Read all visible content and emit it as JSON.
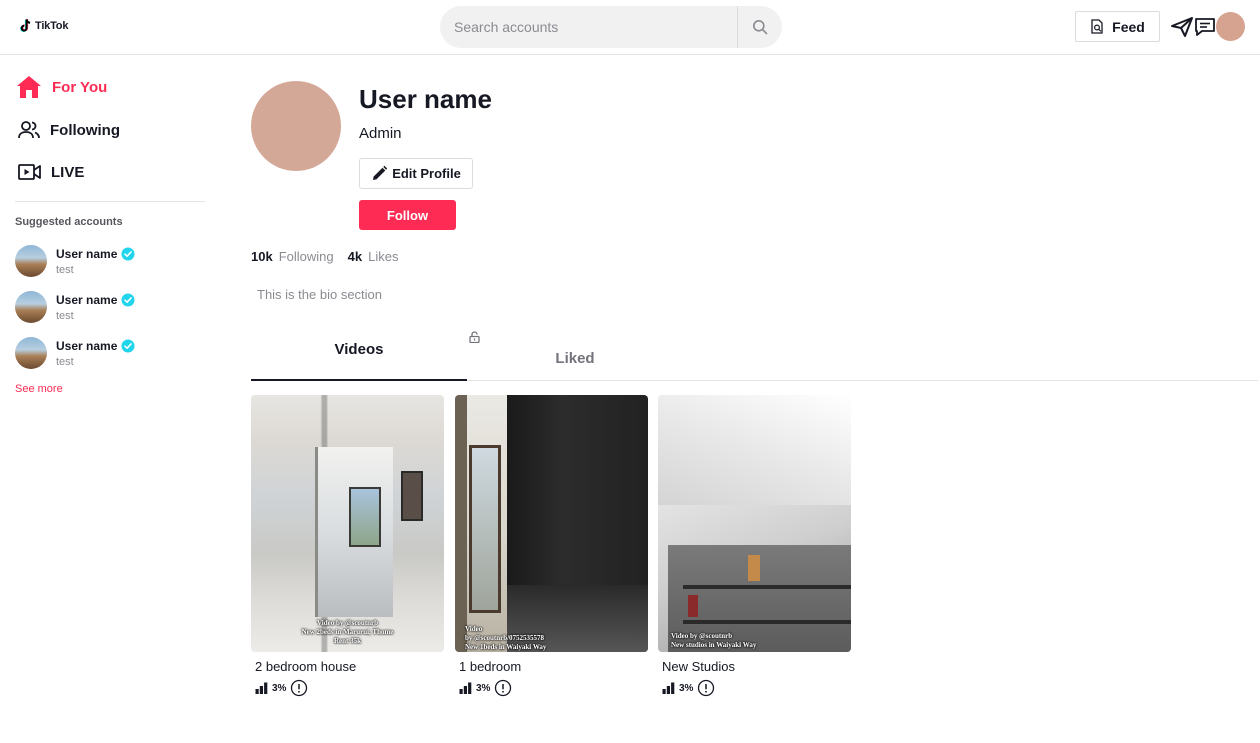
{
  "header": {
    "logo_text": "TikTok",
    "search_placeholder": "Search accounts",
    "feed_label": "Feed"
  },
  "sidebar": {
    "nav": [
      {
        "label": "For You",
        "icon": "home-icon",
        "active": true
      },
      {
        "label": "Following",
        "icon": "users-icon",
        "active": false
      },
      {
        "label": "LIVE",
        "icon": "live-video-icon",
        "active": false
      }
    ],
    "suggested_title": "Suggested accounts",
    "suggested": [
      {
        "name": "User name",
        "handle": "test",
        "verified": true
      },
      {
        "name": "User name",
        "handle": "test",
        "verified": true
      },
      {
        "name": "User name",
        "handle": "test",
        "verified": true
      }
    ],
    "see_more": "See more"
  },
  "profile": {
    "name": "User name",
    "role": "Admin",
    "edit_label": "Edit Profile",
    "follow_label": "Follow",
    "stats": [
      {
        "value": "10k",
        "label": "Following"
      },
      {
        "value": "4k",
        "label": "Likes"
      }
    ],
    "bio": "This is the bio section"
  },
  "tabs": [
    {
      "label": "Videos",
      "active": true
    },
    {
      "label": "Liked",
      "active": false,
      "locked": true
    }
  ],
  "videos": [
    {
      "title": "2 bedroom house",
      "stat": "3%",
      "caption": [
        "Video by @scoutnrb",
        "New 2beds in Marurui, Thome",
        "Rent 35k"
      ]
    },
    {
      "title": "1 bedroom",
      "stat": "3%",
      "caption": [
        "Video",
        "by @scoutnrb/0752535578",
        "New 1beds in Waiyaki Way"
      ]
    },
    {
      "title": "New Studios",
      "stat": "3%",
      "caption": [
        "Video by @scoutnrb",
        "New studios in Waiyaki Way"
      ]
    }
  ],
  "colors": {
    "brand": "#fe2c55",
    "text": "#161823",
    "muted": "#8a8b91",
    "verified": "#20d5ec"
  }
}
